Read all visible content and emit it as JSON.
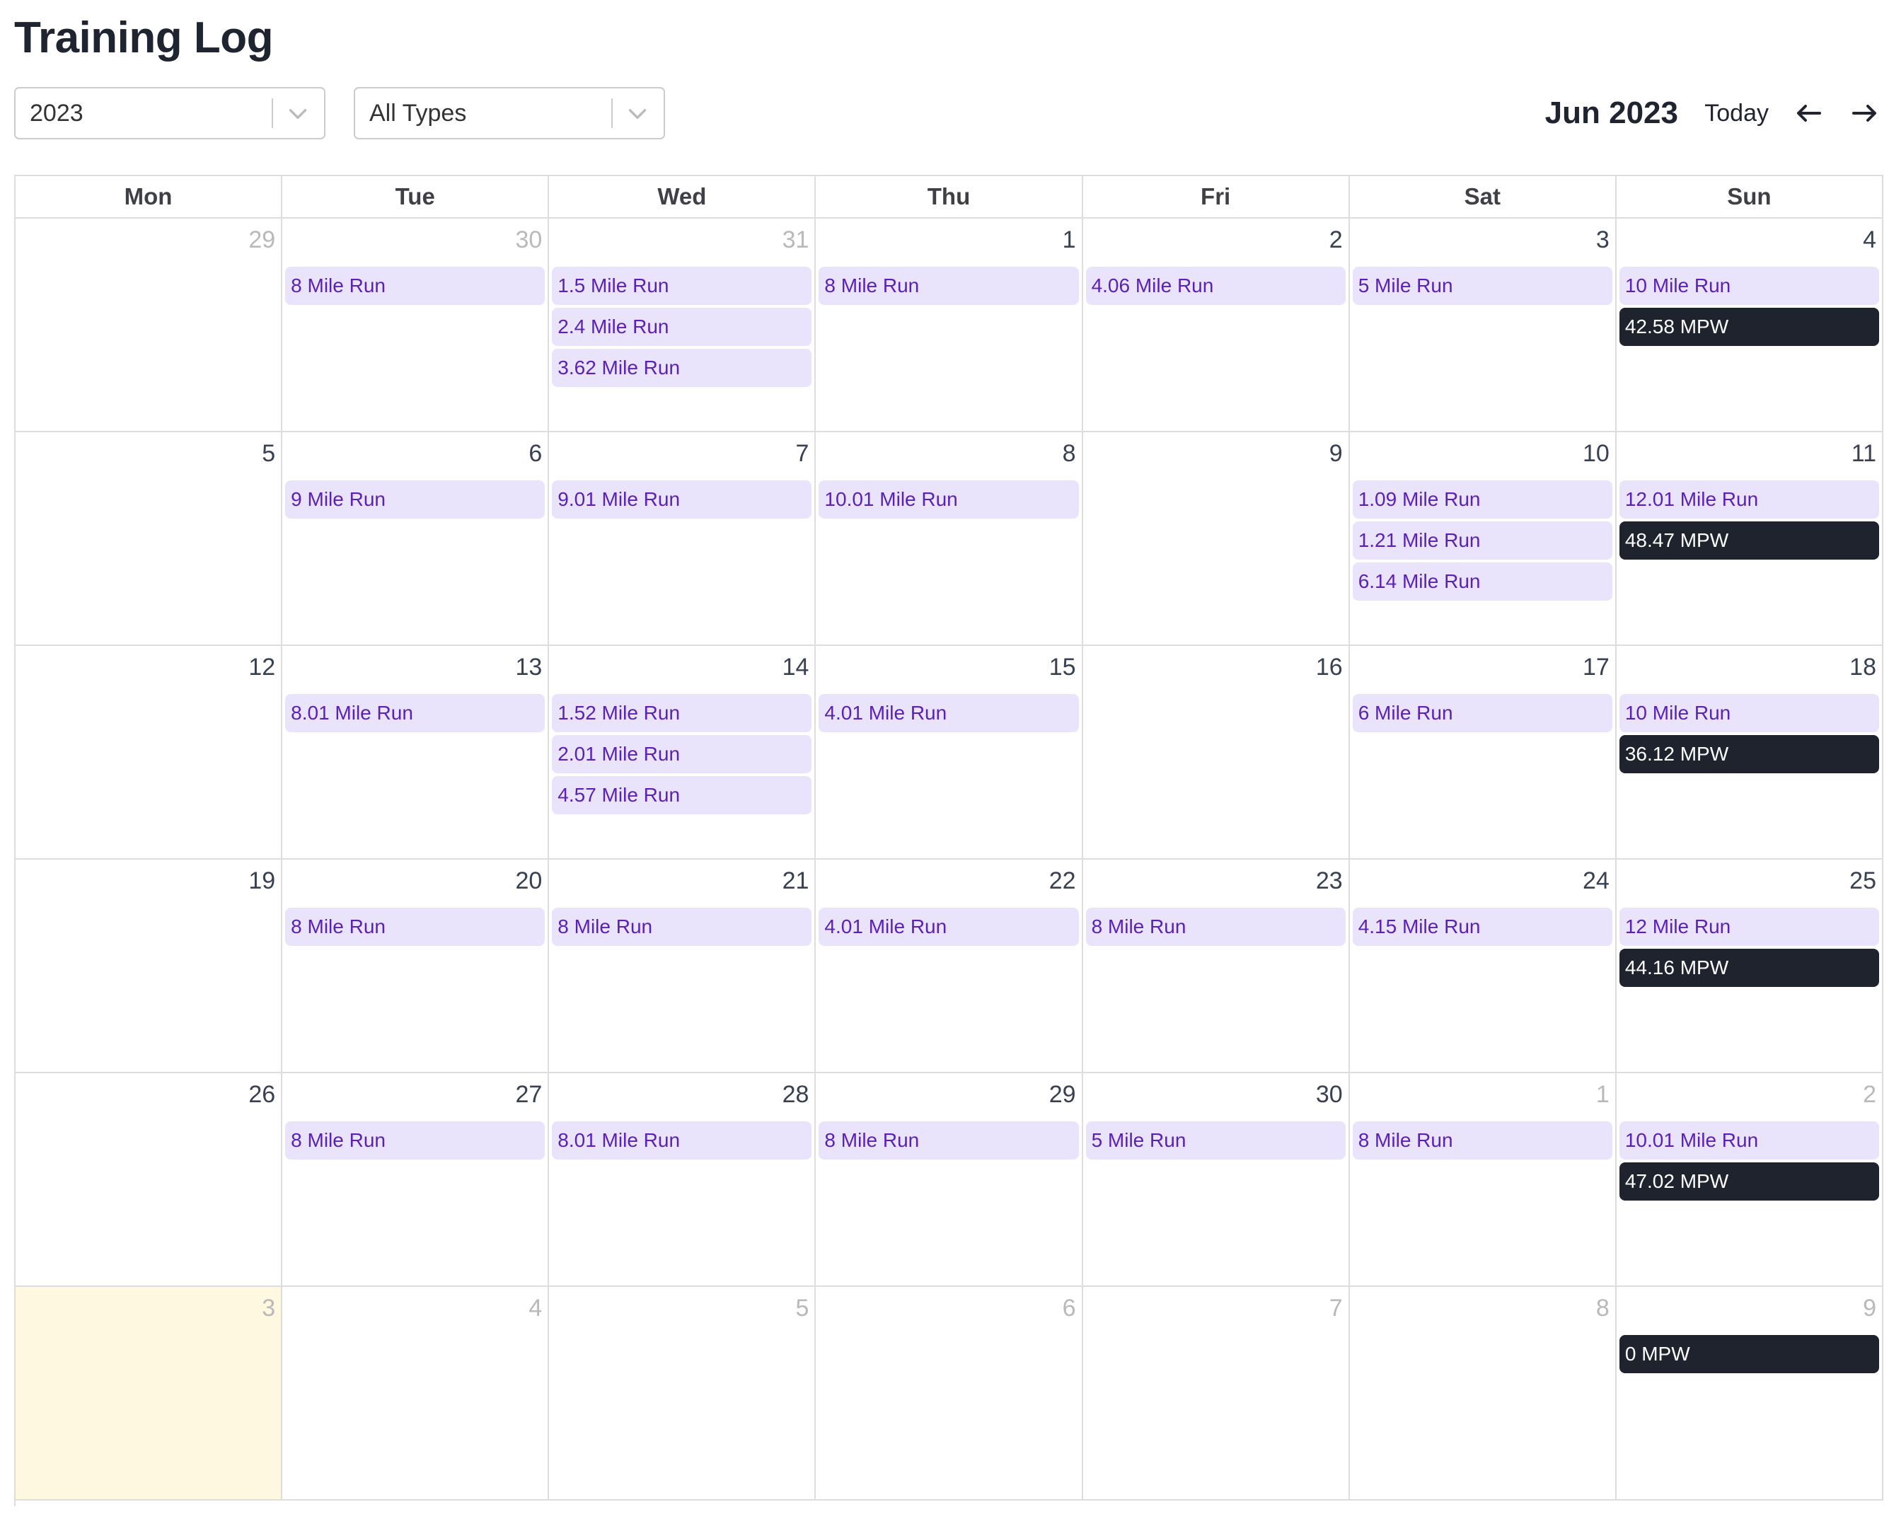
{
  "page": {
    "title": "Training Log"
  },
  "filters": {
    "year": {
      "value": "2023"
    },
    "type": {
      "value": "All Types"
    }
  },
  "toolbar": {
    "month_title": "Jun 2023",
    "today_label": "Today",
    "prev_icon": "arrow-left-icon",
    "next_icon": "arrow-right-icon"
  },
  "colors": {
    "event_bg": "#e9e4fc",
    "event_text": "#5b21b6",
    "mpw_bg": "#1f232d",
    "mpw_text": "#ffffff",
    "today_bg": "#fef8e0"
  },
  "calendar": {
    "weekdays": [
      "Mon",
      "Tue",
      "Wed",
      "Thu",
      "Fri",
      "Sat",
      "Sun"
    ],
    "weeks": [
      [
        {
          "day": "29",
          "muted": true,
          "events": []
        },
        {
          "day": "30",
          "muted": true,
          "events": [
            "8 Mile Run"
          ]
        },
        {
          "day": "31",
          "muted": true,
          "events": [
            "1.5 Mile Run",
            "2.4 Mile Run",
            "3.62 Mile Run"
          ]
        },
        {
          "day": "1",
          "events": [
            "8 Mile Run"
          ]
        },
        {
          "day": "2",
          "events": [
            "4.06 Mile Run"
          ]
        },
        {
          "day": "3",
          "events": [
            "5 Mile Run"
          ]
        },
        {
          "day": "4",
          "events": [
            "10 Mile Run"
          ],
          "summary": "42.58 MPW"
        }
      ],
      [
        {
          "day": "5",
          "events": []
        },
        {
          "day": "6",
          "events": [
            "9 Mile Run"
          ]
        },
        {
          "day": "7",
          "events": [
            "9.01 Mile Run"
          ]
        },
        {
          "day": "8",
          "events": [
            "10.01 Mile Run"
          ]
        },
        {
          "day": "9",
          "events": []
        },
        {
          "day": "10",
          "events": [
            "1.09 Mile Run",
            "1.21 Mile Run",
            "6.14 Mile Run"
          ]
        },
        {
          "day": "11",
          "events": [
            "12.01 Mile Run"
          ],
          "summary": "48.47 MPW"
        }
      ],
      [
        {
          "day": "12",
          "events": []
        },
        {
          "day": "13",
          "events": [
            "8.01 Mile Run"
          ]
        },
        {
          "day": "14",
          "events": [
            "1.52 Mile Run",
            "2.01 Mile Run",
            "4.57 Mile Run"
          ]
        },
        {
          "day": "15",
          "events": [
            "4.01 Mile Run"
          ]
        },
        {
          "day": "16",
          "events": []
        },
        {
          "day": "17",
          "events": [
            "6 Mile Run"
          ]
        },
        {
          "day": "18",
          "events": [
            "10 Mile Run"
          ],
          "summary": "36.12 MPW"
        }
      ],
      [
        {
          "day": "19",
          "events": []
        },
        {
          "day": "20",
          "events": [
            "8 Mile Run"
          ]
        },
        {
          "day": "21",
          "events": [
            "8 Mile Run"
          ]
        },
        {
          "day": "22",
          "events": [
            "4.01 Mile Run"
          ]
        },
        {
          "day": "23",
          "events": [
            "8 Mile Run"
          ]
        },
        {
          "day": "24",
          "events": [
            "4.15 Mile Run"
          ]
        },
        {
          "day": "25",
          "events": [
            "12 Mile Run"
          ],
          "summary": "44.16 MPW"
        }
      ],
      [
        {
          "day": "26",
          "events": []
        },
        {
          "day": "27",
          "events": [
            "8 Mile Run"
          ]
        },
        {
          "day": "28",
          "events": [
            "8.01 Mile Run"
          ]
        },
        {
          "day": "29",
          "events": [
            "8 Mile Run"
          ]
        },
        {
          "day": "30",
          "events": [
            "5 Mile Run"
          ]
        },
        {
          "day": "1",
          "muted": true,
          "events": [
            "8 Mile Run"
          ]
        },
        {
          "day": "2",
          "muted": true,
          "events": [
            "10.01 Mile Run"
          ],
          "summary": "47.02 MPW"
        }
      ],
      [
        {
          "day": "3",
          "muted": true,
          "today": true,
          "events": []
        },
        {
          "day": "4",
          "muted": true,
          "events": []
        },
        {
          "day": "5",
          "muted": true,
          "events": []
        },
        {
          "day": "6",
          "muted": true,
          "events": []
        },
        {
          "day": "7",
          "muted": true,
          "events": []
        },
        {
          "day": "8",
          "muted": true,
          "events": []
        },
        {
          "day": "9",
          "muted": true,
          "events": [],
          "summary": "0 MPW"
        }
      ]
    ]
  }
}
